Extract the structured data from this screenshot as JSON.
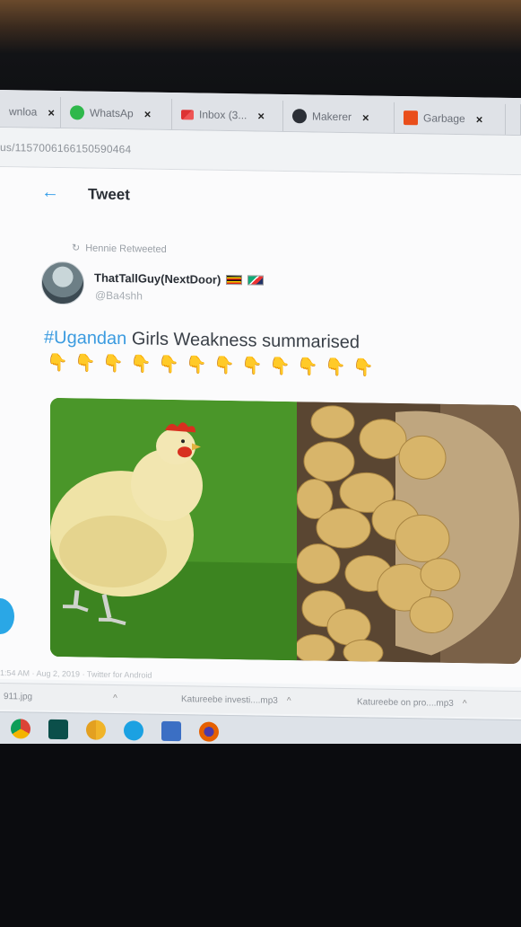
{
  "browser": {
    "tabs": [
      {
        "label": "wnloa",
        "icon": "download-icon",
        "close": "×"
      },
      {
        "label": "WhatsAp",
        "icon": "whatsapp-icon",
        "close": "×"
      },
      {
        "label": "Inbox (3...",
        "icon": "gmail-icon",
        "close": "×"
      },
      {
        "label": "Makerer",
        "icon": "globe-icon",
        "close": "×"
      },
      {
        "label": "Garbage",
        "icon": "u-logo-icon",
        "close": "×"
      }
    ],
    "address": "us/1157006166150590464"
  },
  "tweet_page": {
    "heading": "Tweet",
    "back_symbol": "←",
    "retweet_icon": "↻",
    "retweeted_by": "Hennie Retweeted",
    "author_name": "ThatTallGuy(NextDoor)",
    "author_handle": "@Ba4shh",
    "hashtag": "#Ugandan",
    "text": "Girls Weakness summarised",
    "emojis": [
      "👇",
      "👇",
      "👇",
      "👇",
      "👇",
      "👇",
      "👇",
      "👇",
      "👇",
      "👇",
      "👇",
      "👇"
    ],
    "media": [
      {
        "icon": "chicken-image"
      },
      {
        "icon": "potatoes-image"
      }
    ],
    "meta": "1:54 AM · Aug 2, 2019 · Twitter for Android"
  },
  "downloads": [
    {
      "name": "911.jpg",
      "chevron": "^"
    },
    {
      "name": "Katureebe investi....mp3",
      "chevron": "^"
    },
    {
      "name": "Katureebe on pro....mp3",
      "chevron": "^"
    }
  ],
  "taskbar": [
    "chrome-icon",
    "audition-icon",
    "chrome-canary-icon",
    "skype-icon",
    "control-panel-icon",
    "firefox-icon"
  ],
  "colors": {
    "accent": "#3b9be0",
    "emoji": "#e8c63a"
  }
}
